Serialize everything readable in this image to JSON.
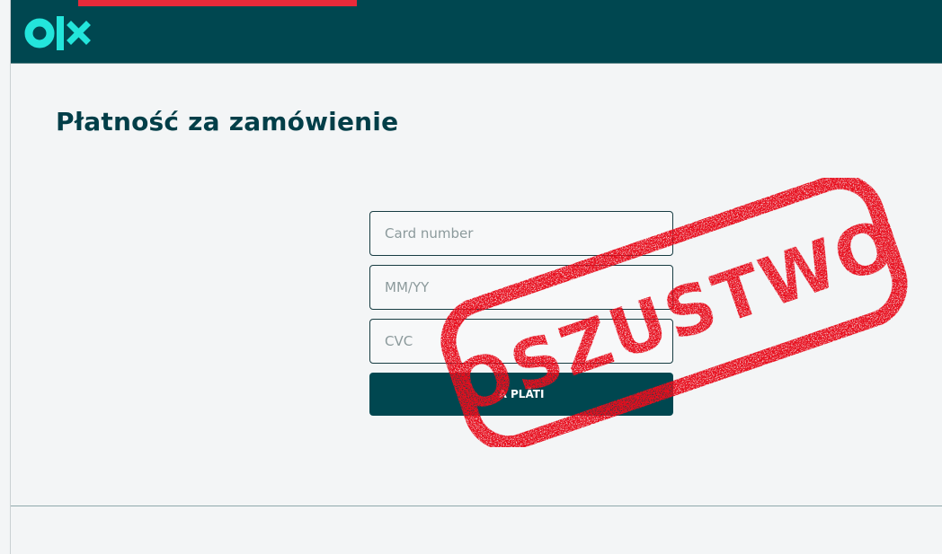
{
  "brand": {
    "logo": "olx",
    "header_color": "#004750",
    "accent": "#23e5db",
    "warning_strip": "#e82a3a"
  },
  "page": {
    "title": "Płatność za zamówienie"
  },
  "form": {
    "card_placeholder": "Card number",
    "expiry_placeholder": "MM/YY",
    "cvc_placeholder": "CVC",
    "pay_label": "A PLĂTI"
  },
  "stamp": {
    "text": "OSZUSTWO",
    "color": "#e8101e"
  }
}
